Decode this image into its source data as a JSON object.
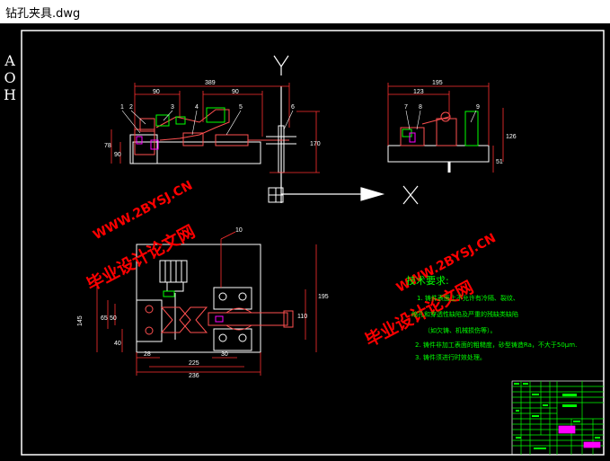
{
  "window": {
    "title": "钻孔夹具.dwg"
  },
  "side_label": [
    "A",
    "O",
    "H"
  ],
  "axes": {
    "y": "Y",
    "x": "X"
  },
  "front_view": {
    "dims": {
      "overall": "389",
      "left": "90",
      "mid": "90",
      "h1": "78",
      "h2": "90",
      "h3": "170"
    },
    "balloons": [
      "1",
      "2",
      "3",
      "4",
      "5",
      "6"
    ]
  },
  "side_view": {
    "dims": {
      "overall": "195",
      "inner": "123",
      "h1": "126",
      "h2": "51"
    },
    "balloons": [
      "7",
      "8",
      "9"
    ]
  },
  "plan_view": {
    "balloon": "10",
    "dims": {
      "h_total": "145",
      "h_a": "65",
      "h_b": "50",
      "h_c": "40",
      "right_a": "195",
      "right_b": "110",
      "bottom_a": "28",
      "bottom_b": "30",
      "bottom_c": "225",
      "bottom_d": "236"
    }
  },
  "watermarks": {
    "left_cn": "毕业设计论文网",
    "left_url": "WWW.2BYSJ.CN",
    "right_cn": "毕业设计论文网",
    "right_url": "WWW.2BYSJ.CN"
  },
  "notes": {
    "heading": "技术要求:",
    "lines": [
      "1. 铸件表面上不允许有冷隔、裂纹、",
      "缩孔和穿透性缺陷及严重的残缺类缺陷",
      "（如欠铸、机械损伤等）。",
      "2. 铸件非加工表面的粗糙度，砂型铸造Ra，不大于50μm.",
      "3. 铸件须进行时效处理。"
    ]
  },
  "colors": {
    "line": "#ffffff",
    "part": "#ff4040",
    "dim": "#ff3030",
    "note": "#00ff00",
    "watermark": "#ff0000",
    "title_block": "#00ff00",
    "highlight": "#ff00ff"
  }
}
